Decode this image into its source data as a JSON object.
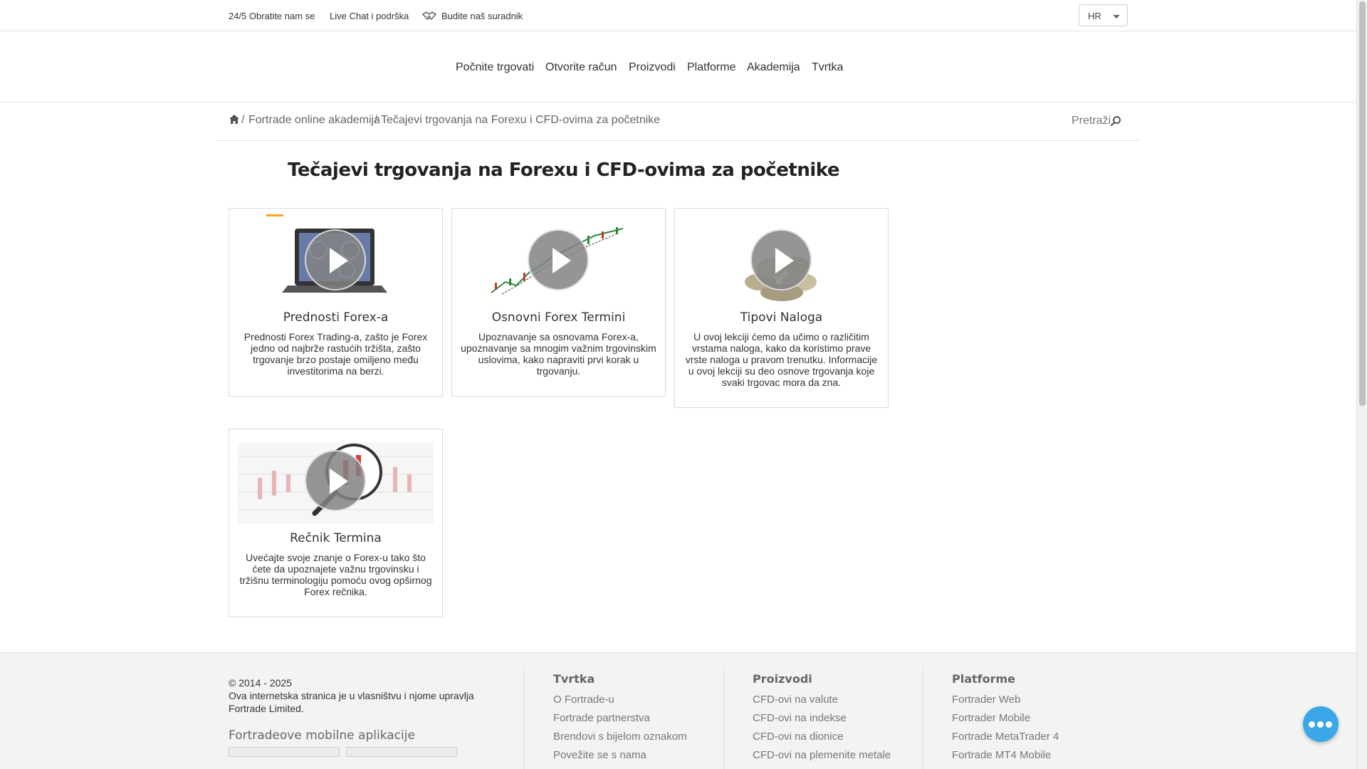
{
  "topbar": {
    "contact": "24/5 Obratite nam se",
    "live_chat": "Live Chat i podrška",
    "partner": "Budite naš suradnik",
    "language": "HR"
  },
  "nav": {
    "items": [
      "Počnite trgovati",
      "Otvorite račun",
      "Proizvodi",
      "Platforme",
      "Akademija",
      "Tvrtka"
    ]
  },
  "breadcrumb": {
    "separator": "/",
    "items": [
      "Fortrade online akademija",
      "Tečajevi trgovanja na Forexu i CFD-ovima za početnike"
    ],
    "search_label": "Pretraži"
  },
  "page_title": "Tečajevi trgovanja na Forexu i CFD-ovima za početnike",
  "courses": [
    {
      "title": "Prednosti Forex-a",
      "description": "Prednosti Forex Trading-a, zašto je Forex jedno od najbrže rastućih tržišta, zašto trgovanje brzo postaje omiljeno među investitorima na berzi."
    },
    {
      "title": "Osnovni Forex Termini",
      "description": "Upoznavanje sa osnovama Forex-a, upoznavanje sa mnogim važnim trgovinskim uslovima, kako napraviti prvi korak u trgovanju."
    },
    {
      "title": "Tipovi Naloga",
      "description": "U ovoj lekciji ćemo da učimo o različitim vrstama naloga, kako da koristimo prave vrste naloga u pravom trenutku. Informacije u ovoj lekciji su deo osnove trgovanja koje svaki trgovac mora da zna."
    },
    {
      "title": "Rečnik Termina",
      "description": "Uvećajte svoje znanje o Forex-u tako što ćete da upoznajete važnu trgovinsku i tržišnu terminologiju pomoću ovog opširnog Forex rečnika."
    }
  ],
  "footer": {
    "copyright": "© 2014 - 2025",
    "ownership": "Ova internetska stranica je u vlasništvu i njome upravlja Fortrade Limited.",
    "apps_title": "Fortradeove mobilne aplikacije",
    "columns": [
      {
        "title": "Tvrtka",
        "links": [
          "O Fortrade-u",
          "Fortrade partnerstva",
          "Brendovi s bijelom oznakom",
          "Povežite se s nama"
        ]
      },
      {
        "title": "Proizvodi",
        "links": [
          "CFD-ovi na valute",
          "CFD-ovi na indekse",
          "CFD-ovi na dionice",
          "CFD-ovi na plemenite metale"
        ]
      },
      {
        "title": "Platforme",
        "links": [
          "Fortrader Web",
          "Fortrader Mobile",
          "Fortrade MetaTrader 4",
          "Fortrade MT4 Mobile"
        ]
      }
    ]
  },
  "colors": {
    "accent": "#f5a623",
    "chat_button": "#3aa8e8",
    "footer_bg": "#f3f3f3"
  },
  "icons": [
    "handshake-icon",
    "home-icon",
    "search-icon",
    "play-icon",
    "chat-bubble-icon"
  ]
}
